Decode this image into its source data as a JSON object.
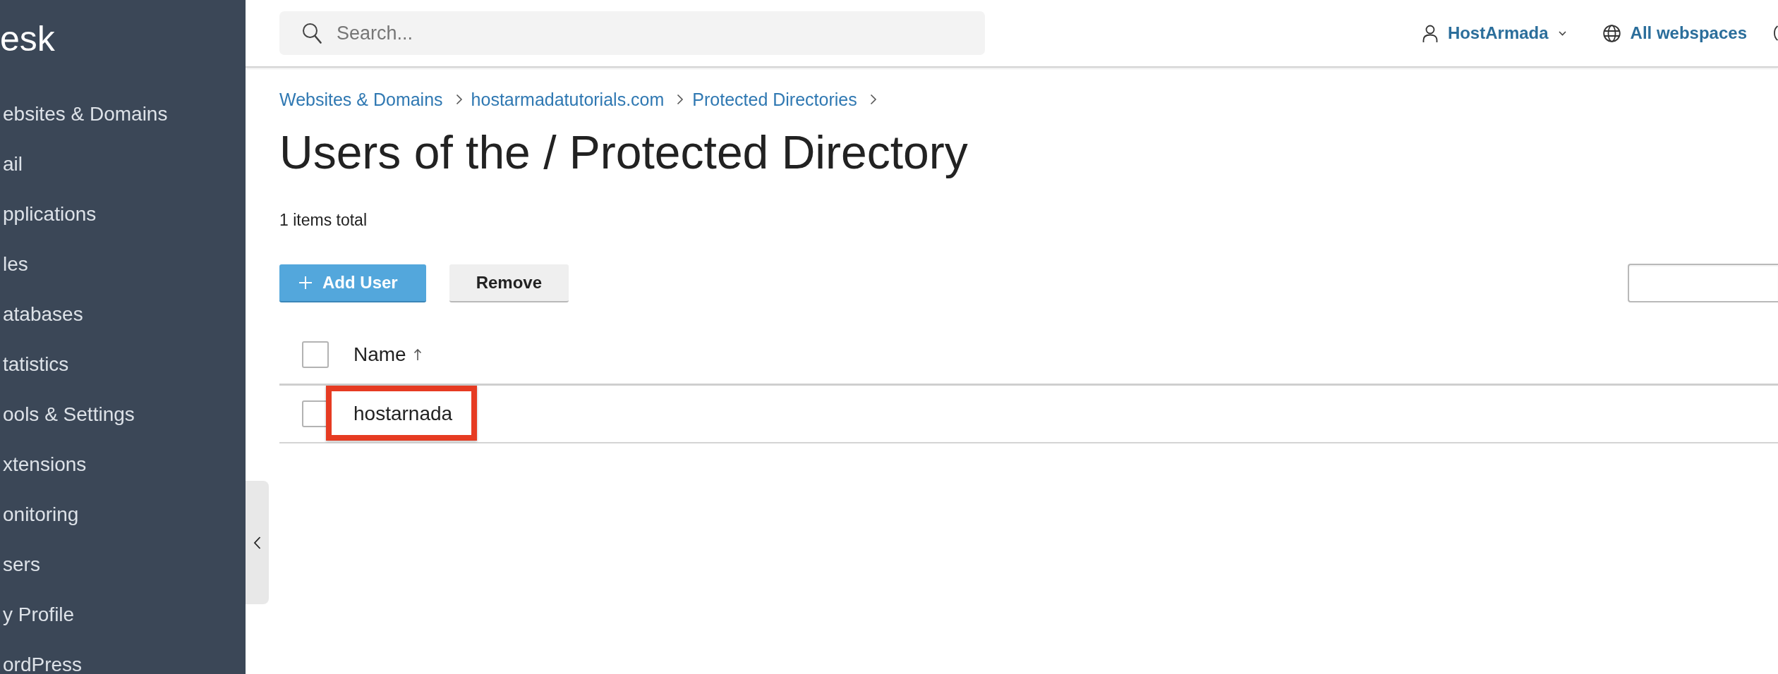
{
  "sidebar": {
    "logo": "esk",
    "items": [
      {
        "label": "ebsites & Domains"
      },
      {
        "label": "ail"
      },
      {
        "label": "pplications"
      },
      {
        "label": "les"
      },
      {
        "label": "atabases"
      },
      {
        "label": "tatistics"
      },
      {
        "label": "ools & Settings"
      },
      {
        "label": "xtensions"
      },
      {
        "label": "onitoring"
      },
      {
        "label": "sers"
      },
      {
        "label": "y Profile"
      },
      {
        "label": "ordPress"
      }
    ]
  },
  "header": {
    "search": {
      "placeholder": "Search..."
    },
    "user_menu": {
      "label": "HostArmada"
    },
    "webspace_menu": {
      "label": "All webspaces"
    }
  },
  "breadcrumbs": [
    {
      "label": "Websites & Domains"
    },
    {
      "label": "hostarmadatutorials.com"
    },
    {
      "label": "Protected Directories"
    }
  ],
  "title": "Users of the / Protected Directory",
  "total": "1 items total",
  "toolbar": {
    "buttons": [
      {
        "label": "Add User",
        "kind": "primary"
      },
      {
        "label": "Remove",
        "kind": "secondary"
      }
    ]
  },
  "table": {
    "select_all": {
      "checked": false
    },
    "columns": [
      {
        "label": "Name",
        "sorted": true
      }
    ],
    "rows": [
      {
        "name": "hostarnada",
        "checked": false,
        "highlighted": true
      }
    ]
  }
}
